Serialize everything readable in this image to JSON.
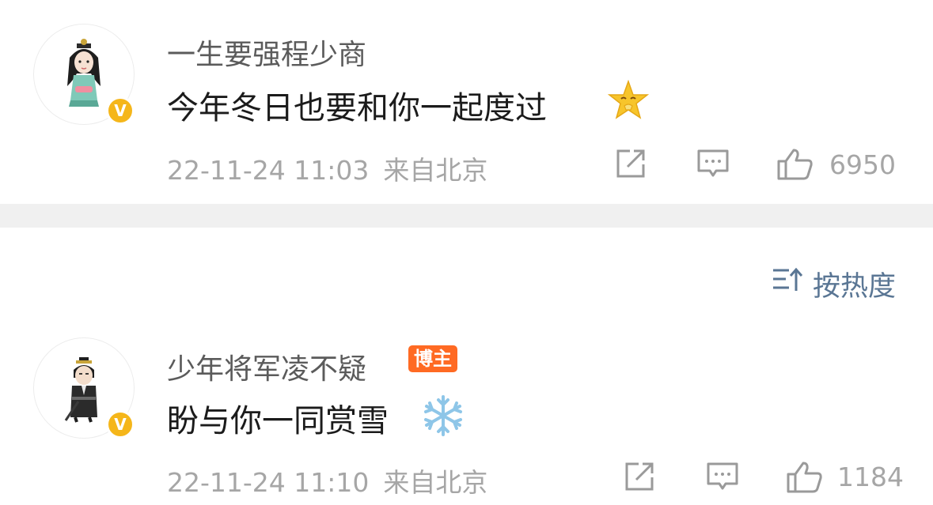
{
  "comments": [
    {
      "username": "一生要强程少商",
      "badge": "",
      "text": "今年冬日也要和你一起度过",
      "emoji": "star-emoji",
      "timestamp": "22-11-24 11:03",
      "location": "来自北京",
      "likes": "6950",
      "verified_mark": "V",
      "verified_color": "#f5b61a"
    },
    {
      "username": "少年将军凌不疑",
      "badge": "博主",
      "text": "盼与你一同赏雪",
      "emoji": "snowflake-emoji",
      "timestamp": "22-11-24 11:10",
      "location": "来自北京",
      "likes": "1184",
      "verified_mark": "V",
      "verified_color": "#f5b61a"
    }
  ],
  "sort": {
    "label": "按热度",
    "icon": "sort-icon",
    "color": "#5a7694"
  },
  "icons": {
    "repost": "repost-icon",
    "comment": "comment-icon",
    "like": "thumbs-up-icon"
  },
  "colors": {
    "host_badge": "#ff6a23",
    "separator": "#f0f0f0"
  }
}
